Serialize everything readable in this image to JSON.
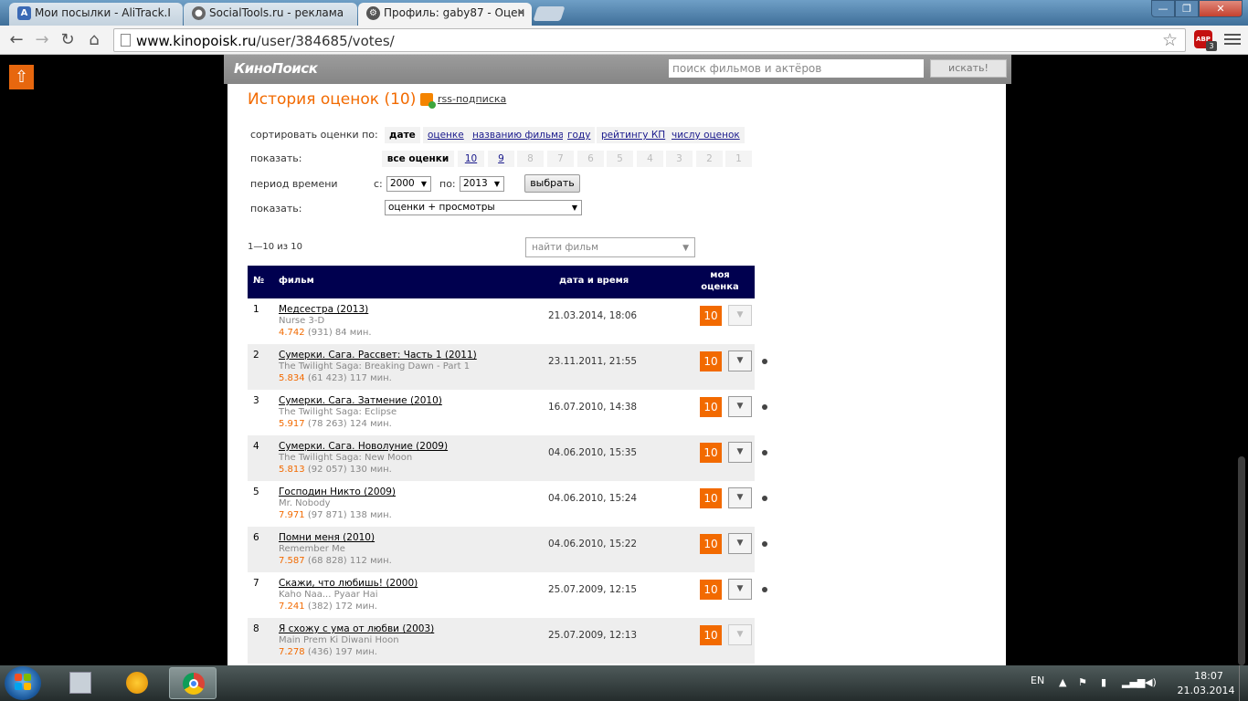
{
  "browser": {
    "tabs": [
      {
        "title": "Мои посылки - AliTrack.I",
        "favicon": "A",
        "favicon_color": "#3b6ab5"
      },
      {
        "title": "SocialTools.ru - реклама",
        "favicon": "●",
        "favicon_color": "#555555"
      },
      {
        "title": "Профиль: gaby87 - Оцен",
        "favicon": "⚙",
        "favicon_color": "#444444"
      }
    ],
    "window_controls": {
      "minimize": "—",
      "maximize": "❐",
      "close": "✕"
    },
    "url_host": "www.kinopoisk.ru",
    "url_path": "/user/384685/votes/",
    "adblock_label": "ABP",
    "adblock_count": "3",
    "icons": {
      "back": "back-arrow-icon",
      "forward": "forward-arrow-icon",
      "reload": "reload-icon",
      "home": "home-icon",
      "bookmark": "star-icon",
      "menu": "hamburger-menu-icon"
    }
  },
  "site": {
    "logo": "КиноПоиск",
    "search_placeholder": "поиск фильмов и актёров",
    "search_button": "искать!",
    "accent_color": "#f26a00",
    "header_color": "#00004f"
  },
  "page": {
    "title": "История оценок (10)",
    "rss": "rss-подписка",
    "sort_label": "сортировать оценки по:",
    "sort_options": [
      "дате",
      "оценке",
      "названию фильма",
      "году",
      "рейтингу КП",
      "числу оценок"
    ],
    "sort_selected": "дате",
    "show_label": "показать:",
    "grade_filters": [
      "все оценки",
      "10",
      "9",
      "8",
      "7",
      "6",
      "5",
      "4",
      "3",
      "2",
      "1"
    ],
    "period_label": "период времени",
    "from_label": "с:",
    "from_value": "2000",
    "to_label": "по:",
    "to_value": "2013",
    "choose_button": "выбрать",
    "show2_label": "показать:",
    "show2_value": "оценки + просмотры",
    "count_text": "1—10 из 10",
    "find_film_placeholder": "найти фильм",
    "table_headers": {
      "num": "№",
      "film": "фильм",
      "date": "дата и время",
      "my_vote": "моя оценка"
    }
  },
  "votes": [
    {
      "num": "1",
      "title": "Медсестра (2013)",
      "original": "Nurse 3-D",
      "rating": "4.742",
      "votes": "(931)",
      "duration": "84 мин.",
      "date": "21.03.2014, 18:06",
      "vote": "10"
    },
    {
      "num": "2",
      "title": "Сумерки. Сага. Рассвет: Часть 1 (2011)",
      "original": "The Twilight Saga: Breaking Dawn - Part 1",
      "rating": "5.834",
      "votes": "(61 423)",
      "duration": "117 мин.",
      "date": "23.11.2011, 21:55",
      "vote": "10"
    },
    {
      "num": "3",
      "title": "Сумерки. Сага. Затмение (2010)",
      "original": "The Twilight Saga: Eclipse",
      "rating": "5.917",
      "votes": "(78 263)",
      "duration": "124 мин.",
      "date": "16.07.2010, 14:38",
      "vote": "10"
    },
    {
      "num": "4",
      "title": "Сумерки. Сага. Новолуние (2009)",
      "original": "The Twilight Saga: New Moon",
      "rating": "5.813",
      "votes": "(92 057)",
      "duration": "130 мин.",
      "date": "04.06.2010, 15:35",
      "vote": "10"
    },
    {
      "num": "5",
      "title": "Господин Никто (2009)",
      "original": "Mr. Nobody",
      "rating": "7.971",
      "votes": "(97 871)",
      "duration": "138 мин.",
      "date": "04.06.2010, 15:24",
      "vote": "10"
    },
    {
      "num": "6",
      "title": "Помни меня (2010)",
      "original": "Remember Me",
      "rating": "7.587",
      "votes": "(68 828)",
      "duration": "112 мин.",
      "date": "04.06.2010, 15:22",
      "vote": "10"
    },
    {
      "num": "7",
      "title": "Скажи, что любишь! (2000)",
      "original": "Kaho Naa... Pyaar Hai",
      "rating": "7.241",
      "votes": "(382)",
      "duration": "172 мин.",
      "date": "25.07.2009, 12:15",
      "vote": "10"
    },
    {
      "num": "8",
      "title": "Я схожу с ума от любви (2003)",
      "original": "Main Prem Ki Diwani Hoon",
      "rating": "7.278",
      "votes": "(436)",
      "duration": "197 мин.",
      "date": "25.07.2009, 12:13",
      "vote": "10"
    }
  ],
  "taskbar": {
    "language": "EN",
    "time": "18:07",
    "date": "21.03.2014",
    "apps": [
      "calculator-icon",
      "aimp-icon",
      "chrome-icon"
    ]
  }
}
